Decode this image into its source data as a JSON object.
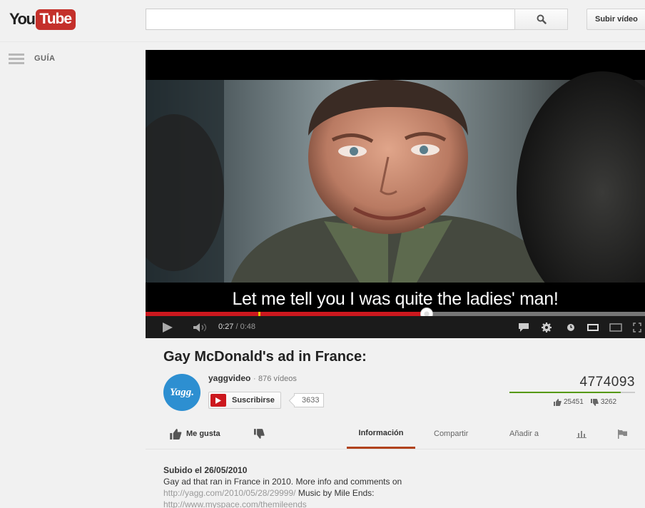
{
  "masthead": {
    "logo_you": "You",
    "logo_tube": "Tube",
    "search_value": "",
    "upload_label": "Subir vídeo"
  },
  "guide": {
    "label": "GUÍA"
  },
  "player": {
    "subtitle": "Let me tell you I was quite the ladies' man!",
    "current_time": "0:27",
    "duration": "/ 0:48",
    "progress_fraction": 0.5625
  },
  "video": {
    "title": "Gay McDonald's ad in France:",
    "channel_name": "yaggvideo",
    "channel_sep": " · ",
    "video_count": "876 vídeos",
    "avatar_text": "Yagg.",
    "subscribe_label": "Suscribirse",
    "subscriber_count": "3633",
    "view_count": "4774093",
    "likes": "25451",
    "dislikes": "3262"
  },
  "actions": {
    "like_label": "Me gusta",
    "tabs": [
      "Información",
      "Compartir",
      "Añadir a"
    ]
  },
  "description": {
    "upload_date": "Subido el 26/05/2010",
    "text1": "Gay ad that ran in France in 2010. More info and comments on",
    "link1": "http://yagg.com/2010/05/28/29999/",
    "text2": " Music by Mile Ends:",
    "link2": "http://www.myspace.com/themileends"
  },
  "colors": {
    "accent_red": "#cc181e",
    "like_green": "#559900",
    "active_tab": "#b1421d",
    "avatar_blue": "#2d8fd1"
  },
  "icons": [
    "search-icon",
    "menu-icon",
    "play-icon",
    "volume-icon",
    "captions-icon",
    "settings-icon",
    "watch-later-icon",
    "small-player-icon",
    "large-player-icon",
    "fullscreen-icon",
    "thumbs-up-icon",
    "thumbs-down-icon",
    "stats-icon",
    "flag-icon"
  ]
}
